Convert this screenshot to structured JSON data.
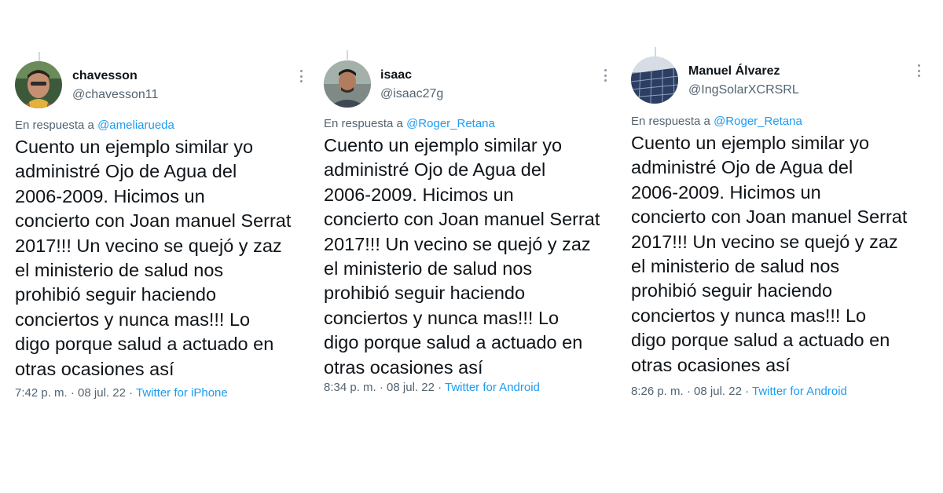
{
  "tweets": [
    {
      "display_name": "chavesson",
      "handle": "@chavesson11",
      "reply_prefix": "En respuesta a ",
      "reply_to": "@ameliarueda",
      "text": "Cuento un ejemplo similar yo\nadministré Ojo de Agua del\n2006-2009.  Hicimos un\nconcierto con Joan manuel Serrat\n2017!!! Un vecino se quejó y zaz\nel ministerio de salud nos\nprohibió seguir haciendo\nconciertos y nunca mas!!!  Lo\ndigo porque salud a actuado en\notras ocasiones así",
      "time": "7:42 p. m.",
      "date": "08 jul. 22",
      "source": "Twitter for iPhone"
    },
    {
      "display_name": "isaac",
      "handle": "@isaac27g",
      "reply_prefix": "En respuesta a ",
      "reply_to": "@Roger_Retana",
      "text": "Cuento un ejemplo similar yo\nadministré Ojo de Agua del\n2006-2009.  Hicimos un\nconcierto con Joan manuel Serrat\n2017!!! Un vecino se quejó y zaz\nel ministerio de salud nos\nprohibió seguir haciendo\nconciertos y nunca mas!!!  Lo\ndigo porque salud a actuado en\notras ocasiones así",
      "time": "8:34 p. m.",
      "date": "08 jul. 22",
      "source": "Twitter for Android"
    },
    {
      "display_name": "Manuel Álvarez",
      "handle": "@IngSolarXCRSRL",
      "reply_prefix": "En respuesta a ",
      "reply_to": "@Roger_Retana",
      "text": "Cuento un ejemplo similar yo\nadministré Ojo de Agua del\n2006-2009.  Hicimos un\nconcierto con Joan manuel Serrat\n2017!!! Un vecino se quejó y zaz\nel ministerio de salud nos\nprohibió seguir haciendo\nconciertos y nunca mas!!!  Lo\ndigo porque salud a actuado en\notras ocasiones así",
      "time": "8:26 p. m.",
      "date": "08 jul. 22",
      "source": "Twitter for Android"
    }
  ],
  "separator": " · ",
  "icons": {
    "more": "more-options-icon",
    "avatar": "avatar"
  },
  "colors": {
    "link": "#1d9bf0",
    "secondary": "#536471",
    "primary": "#0f1419"
  }
}
